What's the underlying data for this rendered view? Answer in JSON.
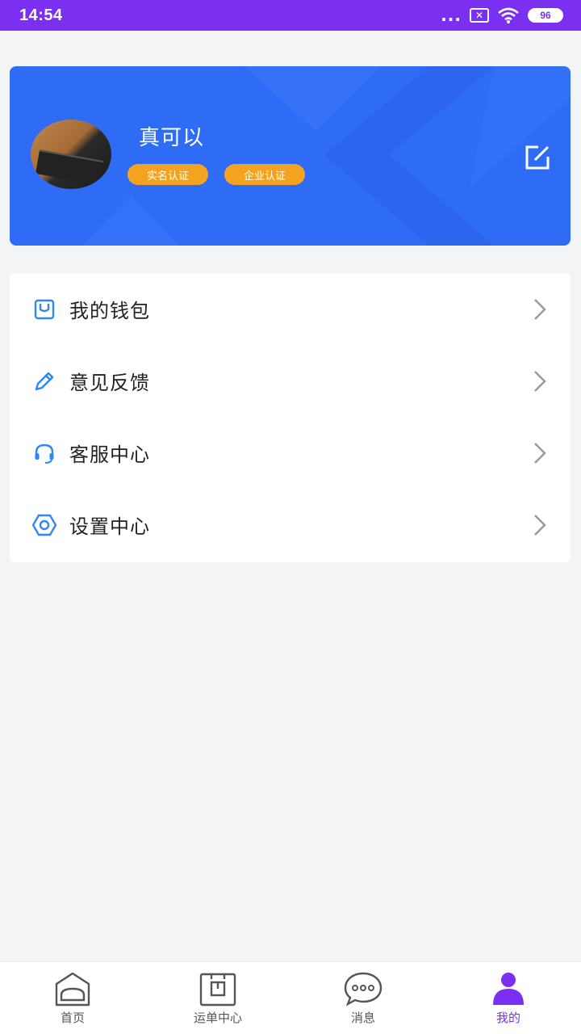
{
  "status_bar": {
    "time": "14:54",
    "dots": "...",
    "battery": "96"
  },
  "profile": {
    "name": "真可以",
    "badges": [
      "实名认证",
      "企业认证"
    ]
  },
  "menu": {
    "items": [
      {
        "label": "我的钱包",
        "icon": "wallet-icon"
      },
      {
        "label": "意见反馈",
        "icon": "pencil-icon"
      },
      {
        "label": "客服中心",
        "icon": "headset-icon"
      },
      {
        "label": "设置中心",
        "icon": "settings-icon"
      }
    ]
  },
  "bottom_nav": {
    "items": [
      {
        "label": "首页",
        "icon": "home-icon"
      },
      {
        "label": "运单中心",
        "icon": "orders-icon"
      },
      {
        "label": "消息",
        "icon": "message-icon"
      },
      {
        "label": "我的",
        "icon": "user-icon",
        "active": true
      }
    ]
  },
  "colors": {
    "accent": "#7b2ff0",
    "card_blue": "#2f6cf6",
    "badge_orange": "#f4a321",
    "icon_blue": "#2f86f6"
  }
}
